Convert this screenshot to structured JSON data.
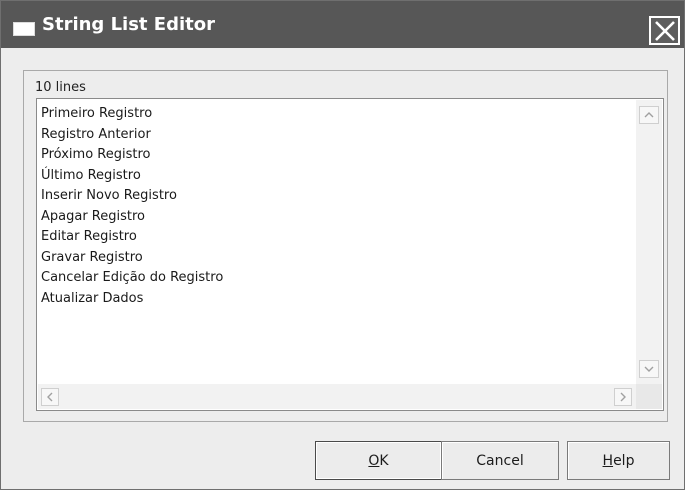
{
  "window": {
    "title": "String List Editor"
  },
  "editor": {
    "line_count": "10 lines",
    "lines": [
      "Primeiro Registro",
      "Registro Anterior",
      "Próximo Registro",
      "Último Registro",
      "Inserir Novo Registro",
      "Apagar Registro",
      "Editar Registro",
      "Gravar Registro",
      "Cancelar Edição do Registro",
      "Atualizar Dados"
    ]
  },
  "buttons": {
    "ok": {
      "mnemonic": "O",
      "rest": "K"
    },
    "cancel": "Cancel",
    "help": {
      "mnemonic": "H",
      "rest": "elp"
    }
  },
  "icons": {
    "title": "window-icon",
    "close": "close-icon",
    "scroll_up": "chevron-up-icon",
    "scroll_down": "chevron-down-icon",
    "scroll_left": "chevron-left-icon",
    "scroll_right": "chevron-right-icon"
  }
}
